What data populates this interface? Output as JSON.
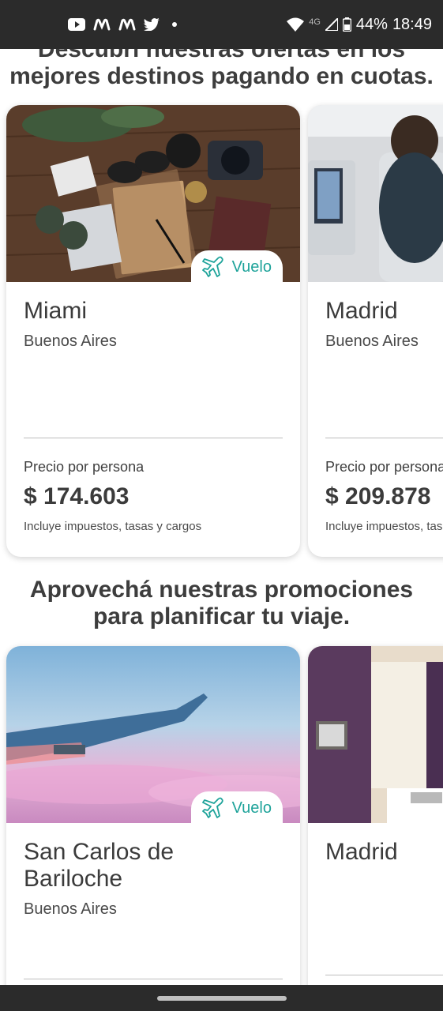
{
  "status_bar": {
    "icons": [
      "youtube-icon",
      "movistar-icon",
      "movistar-icon",
      "twitter-icon"
    ],
    "network": "4G",
    "battery": "44%",
    "time": "18:49"
  },
  "section1": {
    "title_line1": "Descubrí nuestras ofertas en los",
    "title_line2": "mejores destinos pagando en cuotas.",
    "cards": [
      {
        "badge": "Vuelo",
        "city": "Miami",
        "origin": "Buenos Aires",
        "price_label": "Precio por persona",
        "price": "$ 174.603",
        "price_note": "Incluye impuestos, tasas y cargos"
      },
      {
        "city": "Madrid",
        "origin": "Buenos Aires",
        "price_label": "Precio por persona",
        "price": "$ 209.878",
        "price_note": "Incluye impuestos, tasas y cargos"
      }
    ]
  },
  "section2": {
    "title_line1": "Aprovechá nuestras promociones",
    "title_line2": "para planificar tu viaje.",
    "cards": [
      {
        "badge": "Vuelo",
        "city_line1": "San Carlos de",
        "city_line2": "Bariloche",
        "origin": "Buenos Aires"
      },
      {
        "city": "Madrid"
      }
    ]
  },
  "colors": {
    "accent": "#1ea39a",
    "status_bar": "#2b2b2b"
  }
}
